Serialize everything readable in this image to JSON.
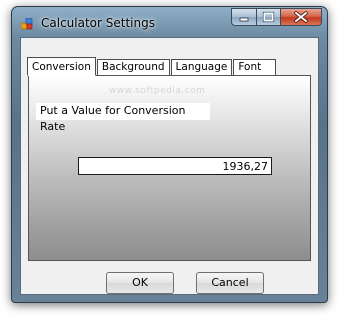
{
  "window": {
    "title": "Calculator Settings",
    "icon": "calculator-app-icon"
  },
  "controls": {
    "minimize_icon": "minimize-icon",
    "maximize_icon": "maximize-icon",
    "close_icon": "close-icon"
  },
  "tabs": [
    {
      "label": "Conversion",
      "active": true
    },
    {
      "label": "Background",
      "active": false
    },
    {
      "label": "Language",
      "active": false
    },
    {
      "label": "Font",
      "active": false
    }
  ],
  "conversion": {
    "prompt": "Put a Value for Conversion Rate",
    "value": "1936,27",
    "watermark": "www.softpedia.com"
  },
  "buttons": {
    "ok": "OK",
    "cancel": "Cancel"
  },
  "colors": {
    "close_button": "#c2391e",
    "frame": "#6d8ba3"
  }
}
